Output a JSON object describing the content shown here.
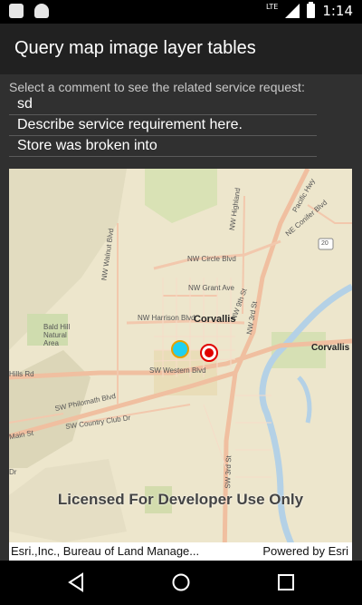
{
  "status_bar": {
    "time": "1:14",
    "network": "LTE",
    "icons": [
      "sd-card-icon",
      "android-icon",
      "signal-icon",
      "battery-icon"
    ]
  },
  "app_bar": {
    "title": "Query map image layer tables"
  },
  "instruction": "Select a comment to see the related service request:",
  "comments": [
    "sd",
    "Describe service requirement here.",
    "Store was broken into"
  ],
  "map": {
    "city_label": "Corvallis",
    "city_label_east": "Corvallis",
    "labels": {
      "nw_circle": "NW Circle Blvd",
      "nw_grant": "NW Grant Ave",
      "nw_harrison": "NW Harrison Blvd",
      "sw_western": "SW Western Blvd",
      "sw_philomath": "SW Philomath Blvd",
      "sw_country_club": "SW Country Club Dr",
      "bald_hill": "Bald Hill Natural Area",
      "conifer": "NE Conifer Blvd",
      "pacific_hwy": "Pacific Hwy",
      "nw_walnut": "NW Walnut Blvd",
      "nw_highland": "NW Highland",
      "nw_9th": "NW 9th St",
      "nw_3rd": "NW 3rd St",
      "hills_rd": "Hills Rd",
      "main_st": "Main St",
      "hwy_20": "20",
      "sw_3rd": "SW 3rd St",
      "sw_dr": "Dr"
    },
    "watermark": "Licensed For Developer Use Only",
    "attribution": "Esri.,Inc., Bureau of Land Manage...",
    "powered_by": "Powered by Esri",
    "marker_colors": {
      "feature": "#1fd0f0",
      "selected": "#e00000"
    }
  },
  "nav_bar": {
    "back": "back-icon",
    "home": "home-icon",
    "recents": "recents-icon"
  }
}
